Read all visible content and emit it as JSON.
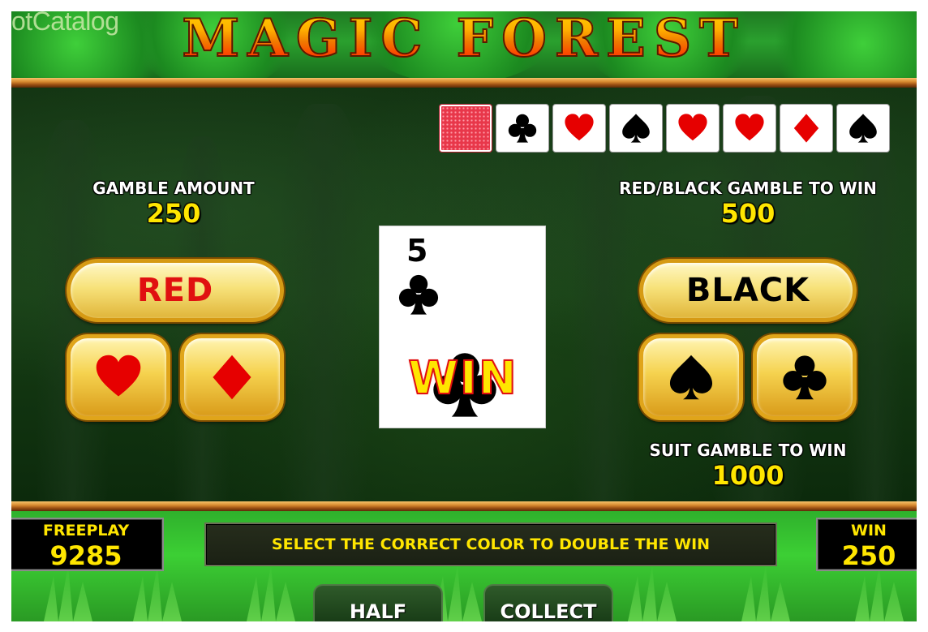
{
  "watermark": "otCatalog",
  "title": "MAGIC FOREST",
  "history": {
    "cards": [
      {
        "type": "back",
        "icon": "card-back-icon"
      },
      {
        "type": "suit",
        "suit": "club",
        "icon": "club-icon",
        "color": "#000000"
      },
      {
        "type": "suit",
        "suit": "heart",
        "icon": "heart-icon",
        "color": "#e60000"
      },
      {
        "type": "suit",
        "suit": "spade",
        "icon": "spade-icon",
        "color": "#000000"
      },
      {
        "type": "suit",
        "suit": "heart",
        "icon": "heart-icon",
        "color": "#e60000"
      },
      {
        "type": "suit",
        "suit": "heart",
        "icon": "heart-icon",
        "color": "#e60000"
      },
      {
        "type": "suit",
        "suit": "diamond",
        "icon": "diamond-icon",
        "color": "#e60000"
      },
      {
        "type": "suit",
        "suit": "spade",
        "icon": "spade-icon",
        "color": "#000000"
      }
    ]
  },
  "left_panel": {
    "label": "GAMBLE AMOUNT",
    "value": "250",
    "color_button": {
      "label": "RED",
      "color": "#e01010"
    },
    "suit_buttons": [
      {
        "suit": "heart",
        "icon": "heart-icon",
        "color": "#e60000"
      },
      {
        "suit": "diamond",
        "icon": "diamond-icon",
        "color": "#e60000"
      }
    ]
  },
  "right_panel": {
    "label": "RED/BLACK GAMBLE TO WIN",
    "value": "500",
    "color_button": {
      "label": "BLACK",
      "color": "#000000"
    },
    "suit_buttons": [
      {
        "suit": "spade",
        "icon": "spade-icon",
        "color": "#000000"
      },
      {
        "suit": "club",
        "icon": "club-icon",
        "color": "#000000"
      }
    ],
    "suit_label": "SUIT GAMBLE TO WIN",
    "suit_value": "1000"
  },
  "card": {
    "rank": "5",
    "suit": "club",
    "icon": "club-icon",
    "overlay_text": "WIN"
  },
  "bottom": {
    "freeplay_label": "FREEPLAY",
    "freeplay_value": "9285",
    "message": "SELECT THE CORRECT COLOR TO DOUBLE THE WIN",
    "win_label": "WIN",
    "win_value": "250",
    "half_label": "HALF",
    "collect_label": "COLLECT"
  },
  "colors": {
    "accent_yellow": "#ffe600",
    "gold": "#d69a14",
    "red": "#e01010"
  }
}
